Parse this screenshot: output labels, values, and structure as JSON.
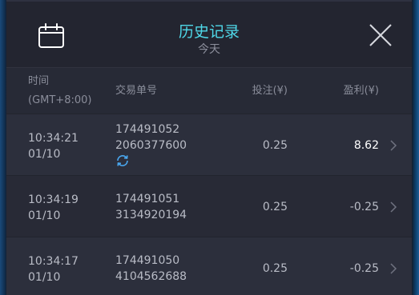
{
  "header": {
    "title": "历史记录",
    "subtitle": "今天",
    "calendar_icon": "calendar-icon",
    "close_icon": "close-icon"
  },
  "columns": {
    "time": "时间",
    "timezone": "(GMT+8:00)",
    "order": "交易单号",
    "bet": "投注(¥)",
    "profit": "盈利(¥)"
  },
  "rows": [
    {
      "time": "10:34:21",
      "date": "01/10",
      "order_line1": "174491052",
      "order_line2": "2060377600",
      "bet": "0.25",
      "profit": "8.62",
      "status_icon": "sync-icon"
    },
    {
      "time": "10:34:19",
      "date": "01/10",
      "order_line1": "174491051",
      "order_line2": "3134920194",
      "bet": "0.25",
      "profit": "-0.25"
    },
    {
      "time": "10:34:17",
      "date": "01/10",
      "order_line1": "174491050",
      "order_line2": "4104562688",
      "bet": "0.25",
      "profit": "-0.25"
    }
  ],
  "colors": {
    "accent": "#4fd8e8",
    "panel": "#232530",
    "positive_profit": "#ffffff"
  }
}
